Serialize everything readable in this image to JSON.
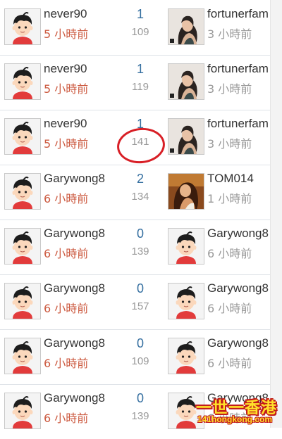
{
  "rows": [
    {
      "author": "never90",
      "author_time": "5 小時前",
      "replies": "1",
      "views": "109",
      "last_poster": "fortunerfam",
      "last_time": "3 小時前"
    },
    {
      "author": "never90",
      "author_time": "5 小時前",
      "replies": "1",
      "views": "119",
      "last_poster": "fortunerfam",
      "last_time": "3 小時前"
    },
    {
      "author": "never90",
      "author_time": "5 小時前",
      "replies": "1",
      "views": "141",
      "last_poster": "fortunerfam",
      "last_time": "3 小時前"
    },
    {
      "author": "Garywong8",
      "author_time": "6 小時前",
      "replies": "2",
      "views": "134",
      "last_poster": "TOM014",
      "last_time": "1 小時前"
    },
    {
      "author": "Garywong8",
      "author_time": "6 小時前",
      "replies": "0",
      "views": "139",
      "last_poster": "Garywong8",
      "last_time": "6 小時前"
    },
    {
      "author": "Garywong8",
      "author_time": "6 小時前",
      "replies": "0",
      "views": "157",
      "last_poster": "Garywong8",
      "last_time": "6 小時前"
    },
    {
      "author": "Garywong8",
      "author_time": "6 小時前",
      "replies": "0",
      "views": "109",
      "last_poster": "Garywong8",
      "last_time": "6 小時前"
    },
    {
      "author": "Garywong8",
      "author_time": "6 小時前",
      "replies": "0",
      "views": "139",
      "last_poster": "Garywong8",
      "last_time": "6 小時前"
    }
  ],
  "watermark": {
    "title": "一世一香港",
    "url": "141hongkong.com"
  },
  "colors": {
    "reply_count": "#356fa0",
    "author_time": "#cc5a40",
    "last_time": "#9a9a9a",
    "highlight": "#d81f26"
  }
}
